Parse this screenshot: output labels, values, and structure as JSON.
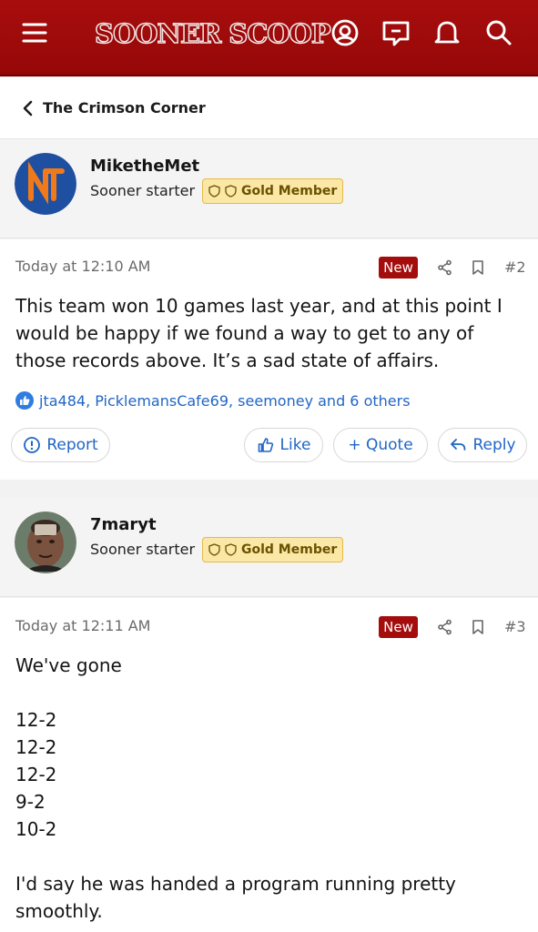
{
  "header": {
    "logo_text": "SOONER SCOOP",
    "icons": [
      "menu-icon",
      "account-icon",
      "messages-icon",
      "alerts-icon",
      "search-icon"
    ],
    "bg_color": "#a10b0b"
  },
  "breadcrumb": {
    "label": "The Crimson Corner"
  },
  "posts": [
    {
      "author": "MiketheMet",
      "user_title": "Sooner starter",
      "badge": "Gold Member",
      "time": "Today at 12:10 AM",
      "new_label": "New",
      "post_number": "#2",
      "body": "This team won 10 games last year, and at this point I would be happy if we found a way to get to any of those records above. It’s a sad state of affairs.",
      "reactions": "jta484, PicklemansCafe69, seemoney and 6 others",
      "actions": {
        "report": "Report",
        "like": "Like",
        "quote": "+ Quote",
        "reply": "Reply"
      }
    },
    {
      "author": "7maryt",
      "user_title": "Sooner starter",
      "badge": "Gold Member",
      "time": "Today at 12:11 AM",
      "new_label": "New",
      "post_number": "#3",
      "body_lines": [
        "We've gone",
        "",
        "12-2",
        "12-2",
        "12-2",
        "9-2",
        "10-2",
        "",
        "I'd say he was handed a program running pretty smoothly."
      ]
    }
  ],
  "colors": {
    "link": "#2166c4",
    "new_tag": "#a50d0d",
    "badge_bg": "#fbe7a6"
  }
}
